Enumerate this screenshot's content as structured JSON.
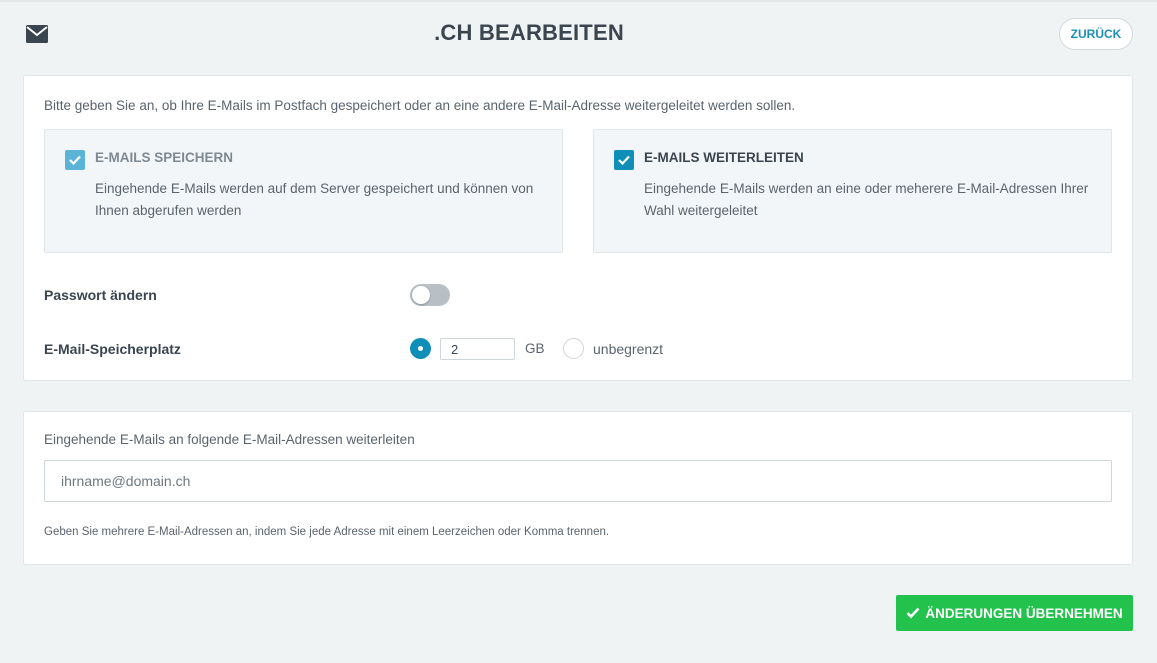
{
  "header": {
    "title": ".CH BEARBEITEN",
    "back_label": "ZURÜCK",
    "icon": "envelope-icon"
  },
  "storage_card": {
    "intro": "Bitte geben Sie an, ob Ihre E-Mails im Postfach gespeichert oder an eine andere E-Mail-Adresse weitergeleitet werden sollen.",
    "options": [
      {
        "title": "E-MAILS SPEICHERN",
        "description": "Eingehende E-Mails werden auf dem Server gespeichert und können von Ihnen abgerufen werden",
        "checked": true,
        "color": "#5bb4d8"
      },
      {
        "title": "E-MAILS WEITERLEITEN",
        "description": "Eingehende E-Mails werden an eine oder meherere E-Mail-Adressen Ihrer Wahl weitergeleitet",
        "checked": true,
        "color": "#0f8fb7"
      }
    ],
    "password": {
      "label": "Passwort ändern",
      "enabled": false
    },
    "quota": {
      "label": "E-Mail-Speicherplatz",
      "value": "2",
      "unit": "GB",
      "unlimited_label": "unbegrenzt",
      "selected": "limited"
    }
  },
  "forward_card": {
    "label": "Eingehende E-Mails an folgende E-Mail-Adressen weiterleiten",
    "placeholder": "ihrname@domain.ch",
    "hint": "Geben Sie mehrere E-Mail-Adressen an, indem Sie jede Adresse mit einem Leerzeichen oder Komma trennen."
  },
  "submit": {
    "label": "ÄNDERUNGEN ÜBERNEHMEN",
    "color": "#22c24c"
  }
}
